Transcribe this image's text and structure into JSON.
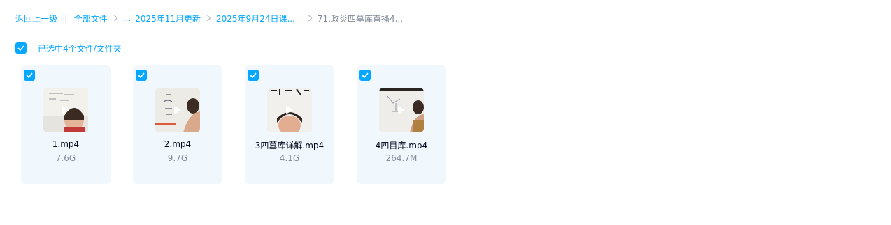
{
  "breadcrumb": {
    "back": "返回上一级",
    "all_files": "全部文件",
    "ellipsis": "...",
    "crumb1": "2025年11月更新",
    "crumb2": "2025年9月24日课...",
    "current": "71.政炎四墓库直播4..."
  },
  "selection": {
    "text": "已选中4个文件/文件夹",
    "accent": "#06a7ff"
  },
  "files": [
    {
      "name": "1.mp4",
      "size": "7.6G",
      "icon": "video-thumbnail"
    },
    {
      "name": "2.mp4",
      "size": "9.7G",
      "icon": "video-thumbnail"
    },
    {
      "name": "3四墓库详解.mp4",
      "size": "4.1G",
      "icon": "video-thumbnail"
    },
    {
      "name": "4四目库.mp4",
      "size": "264.7M",
      "icon": "video-thumbnail"
    }
  ]
}
